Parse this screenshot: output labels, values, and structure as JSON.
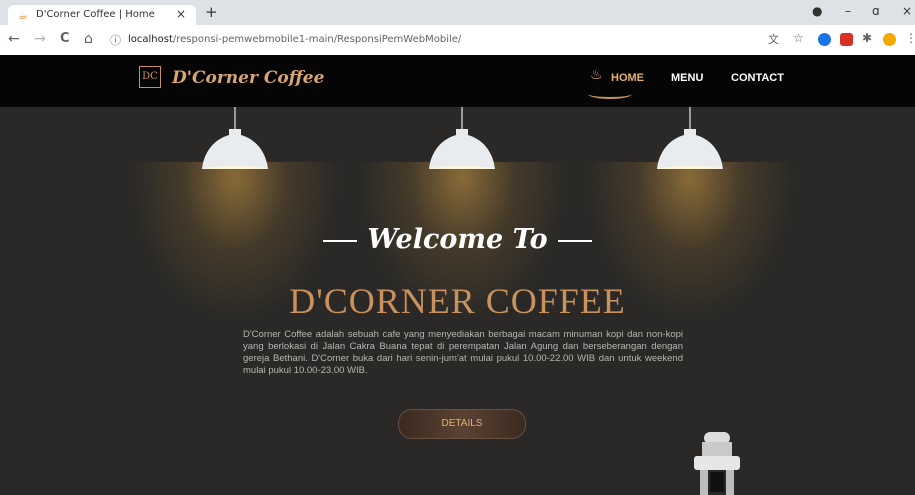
{
  "browser": {
    "tab_title": "D'Corner Coffee | Home",
    "tab_close": "×",
    "new_tab": "+",
    "url_host": "localhost",
    "url_path": "/responsi-pemwebmobile1-main/ResponsiPemWebMobile/",
    "nav": {
      "back": "←",
      "forward": "→",
      "reload": "C",
      "home": "⌂"
    },
    "window": {
      "minimize": "–",
      "maximize": "ɑ",
      "close": "×"
    }
  },
  "site": {
    "logo_mark": "DC",
    "logo_text": "D'Corner Coffee",
    "nav": {
      "home": "HOME",
      "menu": "MENU",
      "contact": "CONTACT"
    },
    "hero": {
      "welcome": "Welcome To",
      "title": "D'CORNER COFFEE",
      "description": "D'Corner Coffee adalah sebuah cafe yang menyediakan berbagai macam minuman kopi dan non-kopi yang berlokasi di Jalan Cakra Buana tepat di perempatan Jalan Agung dan berseberangan dengan gereja Bethani. D'Corner buka dari hari senin-jum'at mulai pukul 10.00-22.00 WIB dan untuk weekend mulai pukul 10.00-23.00 WIB.",
      "details_button": "DETAILS"
    }
  },
  "colors": {
    "accent": "#c9915b",
    "header_bg": "#050505",
    "hero_bg": "#2a2927"
  }
}
